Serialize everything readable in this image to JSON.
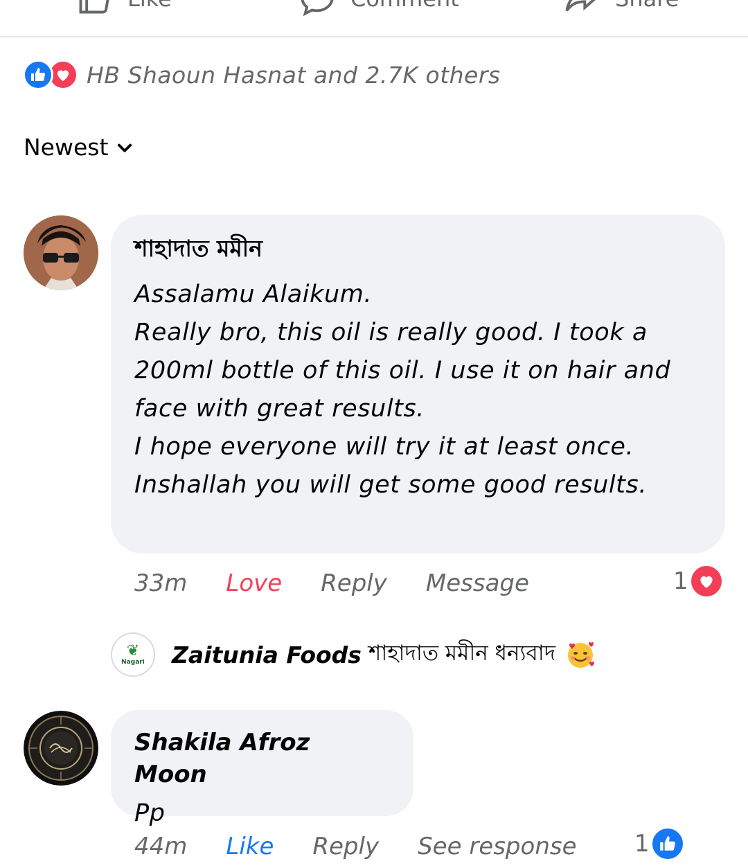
{
  "action_bar": {
    "like_label": "Like",
    "comment_label": "Comment",
    "share_label": "Share"
  },
  "reactions": {
    "icons": [
      "like-icon",
      "love-icon"
    ],
    "summary": "HB Shaoun Hasnat and 2.7K others"
  },
  "sort": {
    "label": "Newest",
    "icon": "chevron-down-icon"
  },
  "comments": [
    {
      "author": "শাহাদাত মমীন",
      "text": "Assalamu Alaikum.\nReally bro, this oil is really good. I took a 200ml bottle of this oil. I use it on hair and face with great results.\nI hope everyone will try it at least once. Inshallah you will get some good results.",
      "time": "33m",
      "reaction_action": "Love",
      "reply_label": "Reply",
      "extra_action": "Message",
      "reaction_count": "1",
      "reaction_icon": "love-icon",
      "replies": [
        {
          "author": "Zaitunia Foods",
          "text": "শাহাদাত মমীন ধন্যবাদ",
          "emoji": "smiling-face-with-hearts",
          "avatar_text": "Nagari"
        }
      ]
    },
    {
      "author": "Shakila Afroz Moon",
      "text": "Pp",
      "time": "44m",
      "reaction_action": "Like",
      "reply_label": "Reply",
      "extra_action": "See response",
      "reaction_count": "1",
      "reaction_icon": "like-icon"
    }
  ],
  "colors": {
    "like_blue": "#1877f2",
    "love_red": "#f33e58",
    "bubble_bg": "#f0f2f5",
    "meta_gray": "#65676b"
  }
}
